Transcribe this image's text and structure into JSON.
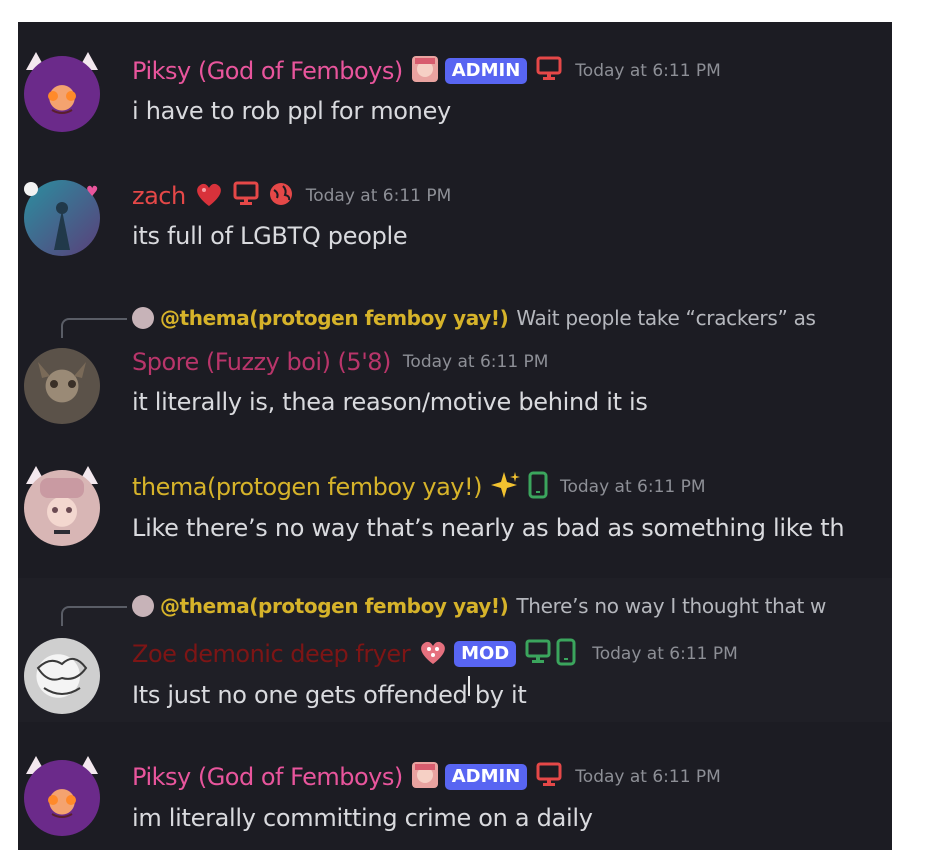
{
  "messages": [
    {
      "username": "Piksy (God of Femboys)",
      "username_color": "#e8559c",
      "badge": "ADMIN",
      "time": "Today at 6:11 PM",
      "text": "i have to rob ppl for money",
      "icons": [
        "anime-avatar-icon",
        "desktop-icon"
      ]
    },
    {
      "username": "zach",
      "username_color": "#e54848",
      "time": "Today at 6:11 PM",
      "text": "its full of LGBTQ people",
      "icons": [
        "heart-icon",
        "desktop-icon",
        "globe-icon"
      ]
    },
    {
      "reply": {
        "username": "@thema(protogen femboy yay!)",
        "text": "Wait people take “crackers” as"
      },
      "username": "Spore (Fuzzy boi) (5'8)",
      "username_color": "#b8356a",
      "time": "Today at 6:11 PM",
      "text": "it literally is, thea reason/motive behind it is",
      "icons": []
    },
    {
      "username": "thema(protogen femboy yay!)",
      "username_color": "#d6b32a",
      "time": "Today at 6:11 PM",
      "text": "Like there’s no way that’s nearly as bad as something like th",
      "icons": [
        "sparkle-icon",
        "mobile-icon"
      ]
    },
    {
      "reply": {
        "username": "@thema(protogen femboy yay!)",
        "text": "There’s no way I thought that w"
      },
      "username": "Zoe demonic deep fryer",
      "username_color": "#7d1515",
      "badge": "MOD",
      "time": "Today at 6:11 PM",
      "text": "Its just no one gets offended by it",
      "icons": [
        "heart-gem-icon",
        "desktop-icon",
        "mobile-icon"
      ]
    },
    {
      "username": "Piksy (God of Femboys)",
      "username_color": "#e8559c",
      "badge": "ADMIN",
      "time": "Today at 6:11 PM",
      "text": "im literally committing crime on a daily",
      "icons": [
        "anime-avatar-icon",
        "desktop-icon"
      ]
    }
  ],
  "colors": {
    "background": "#1c1c23",
    "badge": "#5865f2",
    "desktop_red": "#e54848",
    "desktop_green": "#3ba55d",
    "timestamp": "#8d8f96",
    "message_text": "#d9dade"
  }
}
